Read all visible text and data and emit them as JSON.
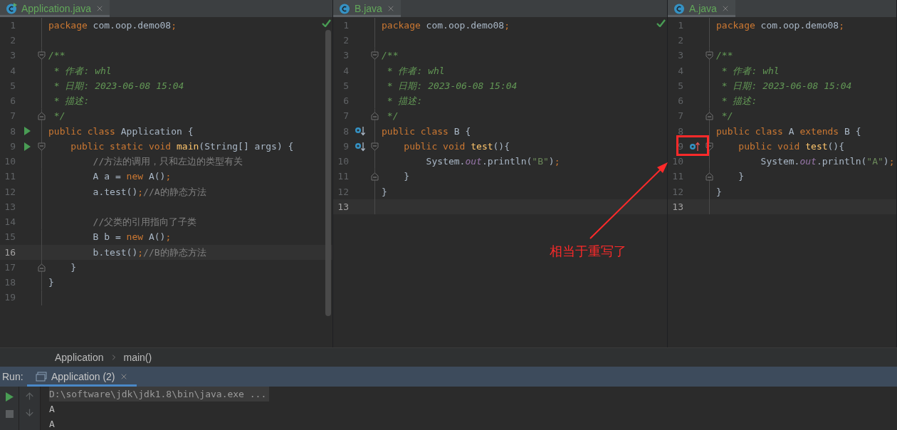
{
  "editors": [
    {
      "tab": {
        "label": "Application.java",
        "runnable": true
      },
      "inspection_ok": true,
      "scrollbar": true,
      "lines": [
        {
          "number": "1",
          "tokens": [
            {
              "kind": "kw",
              "text": "package"
            },
            {
              "kind": "plain",
              "text": " com.oop.demo08"
            },
            {
              "kind": "kw",
              "text": ";"
            }
          ]
        },
        {
          "number": "2"
        },
        {
          "number": "3",
          "fold": {
            "kind": "open"
          },
          "tokens": [
            {
              "kind": "doc",
              "text": "/**"
            }
          ]
        },
        {
          "number": "4",
          "tokens": [
            {
              "kind": "doc",
              "text": " * 作者: whl"
            }
          ]
        },
        {
          "number": "5",
          "tokens": [
            {
              "kind": "doc",
              "text": " * 日期: 2023-06-08 15:04"
            }
          ]
        },
        {
          "number": "6",
          "tokens": [
            {
              "kind": "doc",
              "text": " * 描述:"
            }
          ]
        },
        {
          "number": "7",
          "fold": {
            "kind": "close"
          },
          "tokens": [
            {
              "kind": "doc",
              "text": " */"
            }
          ]
        },
        {
          "number": "8",
          "gutter": {
            "kind": "run"
          },
          "tokens": [
            {
              "kind": "kw",
              "text": "public class "
            },
            {
              "kind": "plain",
              "text": "Application {"
            }
          ]
        },
        {
          "number": "9",
          "gutter": {
            "kind": "run"
          },
          "fold": {
            "kind": "open"
          },
          "tokens": [
            {
              "kind": "kw",
              "text": "    public static void "
            },
            {
              "kind": "method",
              "text": "main"
            },
            {
              "kind": "plain",
              "text": "(String[] args) {"
            }
          ]
        },
        {
          "number": "10",
          "tokens": [
            {
              "kind": "comment",
              "text": "        //方法的调用，只和左边的类型有关"
            }
          ]
        },
        {
          "number": "11",
          "tokens": [
            {
              "kind": "plain",
              "text": "        A a = "
            },
            {
              "kind": "kw",
              "text": "new "
            },
            {
              "kind": "plain",
              "text": "A()"
            },
            {
              "kind": "kw",
              "text": ";"
            }
          ]
        },
        {
          "number": "12",
          "tokens": [
            {
              "kind": "plain",
              "text": "        a.test()"
            },
            {
              "kind": "kw",
              "text": ";"
            },
            {
              "kind": "comment",
              "text": "//A的静态方法"
            }
          ]
        },
        {
          "number": "13"
        },
        {
          "number": "14",
          "tokens": [
            {
              "kind": "comment",
              "text": "        //父类的引用指向了子类"
            }
          ]
        },
        {
          "number": "15",
          "tokens": [
            {
              "kind": "plain",
              "text": "        B b = "
            },
            {
              "kind": "kw",
              "text": "new "
            },
            {
              "kind": "plain",
              "text": "A()"
            },
            {
              "kind": "kw",
              "text": ";"
            }
          ]
        },
        {
          "number": "16",
          "current": true,
          "tokens": [
            {
              "kind": "plain",
              "text": "        b.test()"
            },
            {
              "kind": "kw",
              "text": ";"
            },
            {
              "kind": "comment",
              "text": "//B的静态方法"
            }
          ]
        },
        {
          "number": "17",
          "fold": {
            "kind": "close"
          },
          "tokens": [
            {
              "kind": "plain",
              "text": "    }"
            }
          ]
        },
        {
          "number": "18",
          "tokens": [
            {
              "kind": "plain",
              "text": "}"
            }
          ]
        },
        {
          "number": "19"
        }
      ]
    },
    {
      "tab": {
        "label": "B.java"
      },
      "inspection_ok": true,
      "lines": [
        {
          "number": "1",
          "tokens": [
            {
              "kind": "kw",
              "text": "package"
            },
            {
              "kind": "plain",
              "text": " com.oop.demo08"
            },
            {
              "kind": "kw",
              "text": ";"
            }
          ]
        },
        {
          "number": "2"
        },
        {
          "number": "3",
          "fold": {
            "kind": "open"
          },
          "tokens": [
            {
              "kind": "doc",
              "text": "/**"
            }
          ]
        },
        {
          "number": "4",
          "tokens": [
            {
              "kind": "doc",
              "text": " * 作者: whl"
            }
          ]
        },
        {
          "number": "5",
          "tokens": [
            {
              "kind": "doc",
              "text": " * 日期: 2023-06-08 15:04"
            }
          ]
        },
        {
          "number": "6",
          "tokens": [
            {
              "kind": "doc",
              "text": " * 描述:"
            }
          ]
        },
        {
          "number": "7",
          "fold": {
            "kind": "close"
          },
          "tokens": [
            {
              "kind": "doc",
              "text": " */"
            }
          ]
        },
        {
          "number": "8",
          "gutter": {
            "kind": "overridden"
          },
          "tokens": [
            {
              "kind": "kw",
              "text": "public class "
            },
            {
              "kind": "plain",
              "text": "B {"
            }
          ]
        },
        {
          "number": "9",
          "gutter": {
            "kind": "overridden"
          },
          "fold": {
            "kind": "open"
          },
          "tokens": [
            {
              "kind": "kw",
              "text": "    public void "
            },
            {
              "kind": "method",
              "text": "test"
            },
            {
              "kind": "plain",
              "text": "(){"
            }
          ]
        },
        {
          "number": "10",
          "tokens": [
            {
              "kind": "plain",
              "text": "        System."
            },
            {
              "kind": "field",
              "text": "out"
            },
            {
              "kind": "plain",
              "text": ".println("
            },
            {
              "kind": "string",
              "text": "\"B\""
            },
            {
              "kind": "plain",
              "text": ")"
            },
            {
              "kind": "kw",
              "text": ";"
            }
          ]
        },
        {
          "number": "11",
          "fold": {
            "kind": "close"
          },
          "tokens": [
            {
              "kind": "plain",
              "text": "    }"
            }
          ]
        },
        {
          "number": "12",
          "tokens": [
            {
              "kind": "plain",
              "text": "}"
            }
          ]
        },
        {
          "number": "13",
          "current": true
        }
      ]
    },
    {
      "tab": {
        "label": "A.java"
      },
      "lines": [
        {
          "number": "1",
          "tokens": [
            {
              "kind": "kw",
              "text": "package"
            },
            {
              "kind": "plain",
              "text": " com.oop.demo08"
            },
            {
              "kind": "kw",
              "text": ";"
            }
          ]
        },
        {
          "number": "2"
        },
        {
          "number": "3",
          "fold": {
            "kind": "open"
          },
          "tokens": [
            {
              "kind": "doc",
              "text": "/**"
            }
          ]
        },
        {
          "number": "4",
          "tokens": [
            {
              "kind": "doc",
              "text": " * 作者: whl"
            }
          ]
        },
        {
          "number": "5",
          "tokens": [
            {
              "kind": "doc",
              "text": " * 日期: 2023-06-08 15:04"
            }
          ]
        },
        {
          "number": "6",
          "tokens": [
            {
              "kind": "doc",
              "text": " * 描述:"
            }
          ]
        },
        {
          "number": "7",
          "fold": {
            "kind": "close"
          },
          "tokens": [
            {
              "kind": "doc",
              "text": " */"
            }
          ]
        },
        {
          "number": "8",
          "tokens": [
            {
              "kind": "kw",
              "text": "public class "
            },
            {
              "kind": "plain",
              "text": "A "
            },
            {
              "kind": "kw",
              "text": "extends "
            },
            {
              "kind": "plain",
              "text": "B {"
            }
          ]
        },
        {
          "number": "9",
          "gutter": {
            "kind": "overrides"
          },
          "fold": {
            "kind": "open"
          },
          "tokens": [
            {
              "kind": "kw",
              "text": "    public void "
            },
            {
              "kind": "method",
              "text": "test"
            },
            {
              "kind": "plain",
              "text": "(){"
            }
          ]
        },
        {
          "number": "10",
          "tokens": [
            {
              "kind": "plain",
              "text": "        System."
            },
            {
              "kind": "field",
              "text": "out"
            },
            {
              "kind": "plain",
              "text": ".println("
            },
            {
              "kind": "string",
              "text": "\"A\""
            },
            {
              "kind": "plain",
              "text": ")"
            },
            {
              "kind": "kw",
              "text": ";"
            }
          ]
        },
        {
          "number": "11",
          "fold": {
            "kind": "close"
          },
          "tokens": [
            {
              "kind": "plain",
              "text": "    }"
            }
          ]
        },
        {
          "number": "12",
          "tokens": [
            {
              "kind": "plain",
              "text": "}"
            }
          ]
        },
        {
          "number": "13",
          "current": true
        }
      ]
    }
  ],
  "breadcrumb": [
    "Application",
    "main()"
  ],
  "run_panel": {
    "label": "Run:",
    "tab": "Application (2)",
    "console": [
      {
        "text": "D:\\software\\jdk\\jdk1.8\\bin\\java.exe ...",
        "kind": "command"
      },
      {
        "text": "A",
        "kind": "output"
      },
      {
        "text": "A",
        "kind": "output"
      }
    ]
  },
  "annotation": {
    "text": "相当于重写了"
  }
}
